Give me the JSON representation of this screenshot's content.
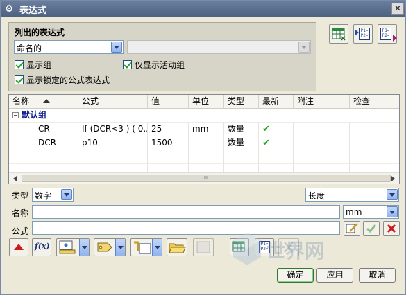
{
  "window": {
    "title": "表达式"
  },
  "list_group": {
    "title": "列出的表达式",
    "filter_selected": "命名的",
    "filter2_selected": "",
    "show_groups": "显示组",
    "show_active_only": "仅显示活动组",
    "show_locked": "显示锁定的公式表达式"
  },
  "table": {
    "columns": [
      "名称",
      "公式",
      "值",
      "单位",
      "类型",
      "最新",
      "附注",
      "检查"
    ],
    "group_label": "默认组",
    "rows": [
      {
        "name": "CR",
        "formula": "If (DCR<3 ) ( 0...",
        "value": "25",
        "unit": "mm",
        "type": "数量",
        "latest": "✔",
        "note": "",
        "check": ""
      },
      {
        "name": "DCR",
        "formula": "p10",
        "value": "1500",
        "unit": "",
        "type": "数量",
        "latest": "✔",
        "note": "",
        "check": ""
      }
    ],
    "scroll_grip": "III"
  },
  "editor": {
    "type_label": "类型",
    "type_value": "数字",
    "dimension_value": "长度",
    "name_label": "名称",
    "name_value": "",
    "unit_value": "mm",
    "formula_label": "公式",
    "formula_value": ""
  },
  "toolbar_icons": {
    "func": "f(x)",
    "pp": "P1= P2="
  },
  "buttons": {
    "ok": "确定",
    "apply": "应用",
    "cancel": "取消"
  },
  "watermark": {
    "text": "世界网"
  },
  "colors": {
    "titlebar": "#5a6f8f",
    "group_text": "#0b1a8c",
    "check_green": "#1ba31b",
    "delete_red": "#cc1b1b"
  }
}
